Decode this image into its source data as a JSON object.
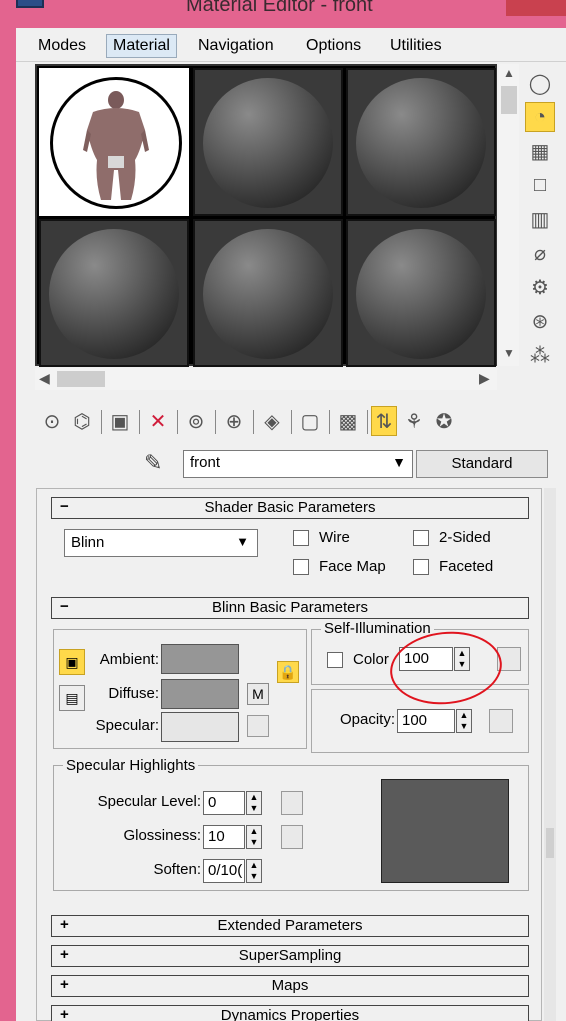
{
  "window": {
    "title": "Material Editor - front"
  },
  "menu": [
    {
      "label": "Modes"
    },
    {
      "label": "Material"
    },
    {
      "label": "Navigation"
    },
    {
      "label": "Options"
    },
    {
      "label": "Utilities"
    }
  ],
  "slot_icons": {
    "side": [
      "sample-type-sphere-icon",
      "backlight-icon",
      "background-checker-icon",
      "sample-uv-tiling-icon",
      "video-color-check-icon",
      "make-preview-icon",
      "options-icon",
      "select-by-material-icon",
      "material-map-navigator-icon"
    ],
    "toolbar": [
      "get-material-icon",
      "put-material-icon",
      "assign-material-icon",
      "reset-map-icon",
      "make-unique-icon",
      "put-library-icon",
      "material-id-channel-icon",
      "show-map-icon",
      "show-end-result-icon",
      "go-to-parent-icon",
      "go-forward-sibling-icon"
    ]
  },
  "material": {
    "name": "front",
    "type": "Standard"
  },
  "shader_basic": {
    "title": "Shader Basic Parameters",
    "shader": "Blinn",
    "wire": "Wire",
    "two_sided": "2-Sided",
    "face_map": "Face Map",
    "faceted": "Faceted"
  },
  "blinn_basic": {
    "title": "Blinn Basic Parameters",
    "self_illumination": "Self-Illumination",
    "color_label": "Color",
    "self_illum_value": "100",
    "ambient": "Ambient:",
    "diffuse": "Diffuse:",
    "specular": "Specular:",
    "m_label": "M",
    "opacity_label": "Opacity:",
    "opacity_value": "100",
    "colors": {
      "ambient": "#969696",
      "diffuse": "#969696",
      "specular": "#e6e6e6"
    }
  },
  "specular_highlights": {
    "title": "Specular Highlights",
    "specular_level_label": "Specular Level:",
    "specular_level_value": "0",
    "glossiness_label": "Glossiness:",
    "glossiness_value": "10",
    "soften_label": "Soften:",
    "soften_value": "0/10("
  },
  "rollouts": [
    {
      "label": "Extended Parameters"
    },
    {
      "label": "SuperSampling"
    },
    {
      "label": "Maps"
    },
    {
      "label": "Dynamics Properties"
    }
  ]
}
